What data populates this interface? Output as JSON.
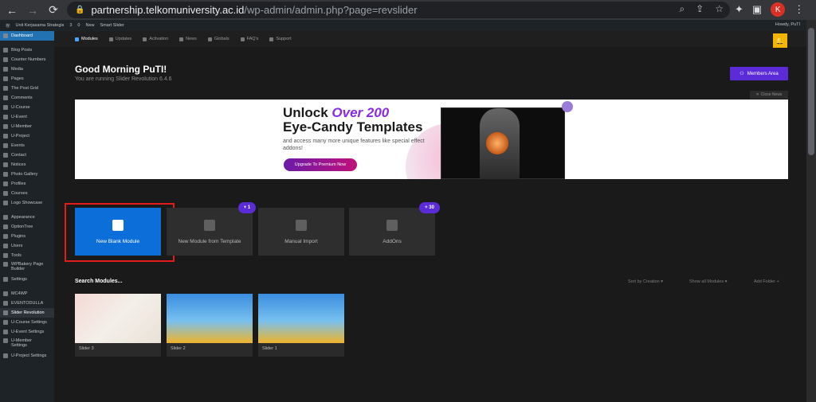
{
  "browser": {
    "url_host": "partnership.telkomuniversity.ac.id",
    "url_path": "/wp-admin/admin.php?page=revslider",
    "avatar_letter": "K"
  },
  "adminbar": {
    "site_name": "Unit Kerjasama Strategis",
    "updates": "3",
    "comments": "0",
    "new": "New",
    "smart_slider": "Smart Slider",
    "howdy": "Howdy, PuTI"
  },
  "sidebar": {
    "items": [
      "Dashboard",
      "Blog Posts",
      "Counter Numbers",
      "Media",
      "Pages",
      "The Post Grid",
      "Comments",
      "U-Course",
      "U-Event",
      "U-Member",
      "U-Project",
      "Events",
      "Contact",
      "Notices",
      "Photo Gallery",
      "Profiles",
      "Courses",
      "Logo Showcase",
      "Appearance",
      "OptionTree",
      "Plugins",
      "Users",
      "Tools",
      "WPBakery Page Builder",
      "Settings",
      "MC4WP",
      "EVENTODULLA",
      "Slider Revolution",
      "U-Course Settings",
      "U-Event Settings",
      "U-Member Settings",
      "U-Project Settings"
    ]
  },
  "rs_nav": {
    "items": [
      "Modules",
      "Updates",
      "Activation",
      "News",
      "Globals",
      "FAQ's",
      "Support"
    ]
  },
  "header": {
    "greeting": "Good Morning PuTI!",
    "version": "You are running Slider Revolution 6.4.6",
    "members_button": "Members Area",
    "close_news": "Close News"
  },
  "banner": {
    "line1_pre": "Unlock ",
    "line1_highlight": "Over 200",
    "line2": "Eye-Candy Templates",
    "subtitle": "and access many more unique features like special effect addons!",
    "cta": "Upgrade To Premium Now"
  },
  "tiles": {
    "new_blank": "New Blank Module",
    "from_template": "New Module from Template",
    "manual_import": "Manual Import",
    "addons": "AddOns",
    "template_badge": "+ 1",
    "addons_badge": "+ 30"
  },
  "modules": {
    "search_label": "Search Modules...",
    "sort": "Sort by Creation",
    "show": "Show all Modules",
    "add_folder": "Add Folder",
    "cards": [
      "Slider 3",
      "Slider 2",
      "Slider 1"
    ]
  },
  "colors": {
    "accent_blue": "#0c6ed9",
    "accent_purple": "#5a2bd6",
    "highlight_red": "#e51b1b",
    "wp_sidebar": "#1d2327"
  }
}
